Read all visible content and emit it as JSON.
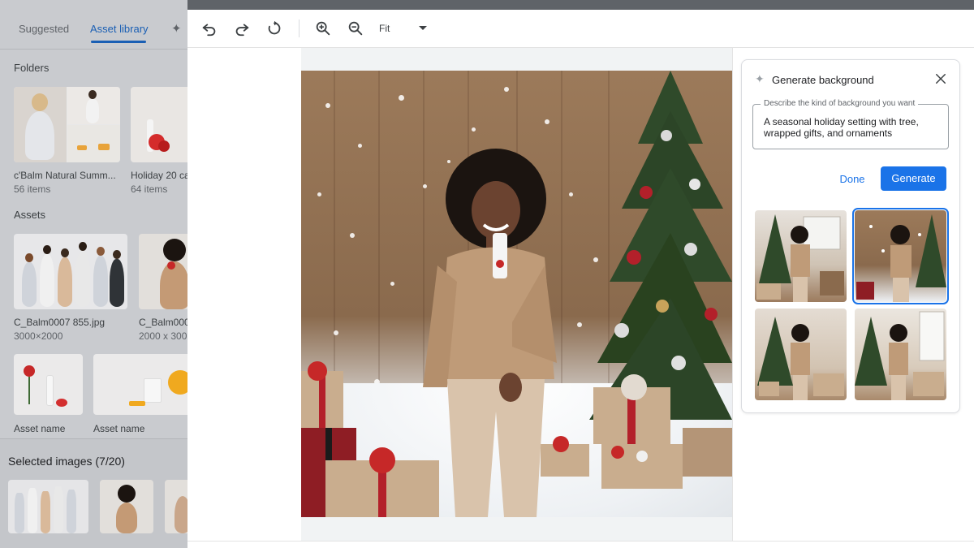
{
  "left_panel": {
    "tabs": [
      {
        "label": "Suggested",
        "active": false
      },
      {
        "label": "Asset library",
        "active": true
      }
    ],
    "folders_heading": "Folders",
    "folders": [
      {
        "title": "c'Balm Natural Summ...",
        "subtitle": "56 items"
      },
      {
        "title": "Holiday 20 ca",
        "subtitle": "64 items"
      }
    ],
    "assets_heading": "Assets",
    "assets": [
      {
        "title": "C_Balm0007 855.jpg",
        "subtitle": "3000×2000"
      },
      {
        "title": "C_Balm000",
        "subtitle": "2000 x 300"
      },
      {
        "title": "Asset name",
        "subtitle": ""
      },
      {
        "title": "Asset name",
        "subtitle": ""
      }
    ],
    "selected_images_label": "Selected images (7/20)"
  },
  "toolbar": {
    "zoom_label": "Fit"
  },
  "generate_panel": {
    "title": "Generate background",
    "prompt_label": "Describe the kind of background you want",
    "prompt_text": "A seasonal holiday setting with tree, wrapped gifts, and ornaments",
    "done_label": "Done",
    "generate_label": "Generate",
    "selected_option": 1
  },
  "colors": {
    "accent": "#1a73e8",
    "panel_dim": "#c9cbcf",
    "wood": "#9c7a5a",
    "tree": "#2f4a2a",
    "gift_red": "#b3202a"
  },
  "icons": [
    "undo-icon",
    "redo-icon",
    "reset-icon",
    "zoom-in-icon",
    "zoom-out-icon",
    "caret-down-icon",
    "sparkle-icon",
    "close-icon"
  ]
}
